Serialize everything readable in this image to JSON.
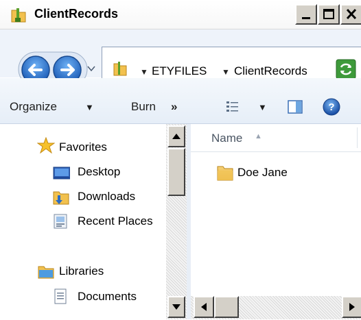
{
  "window": {
    "title": "ClientRecords"
  },
  "address": {
    "crumbs": [
      "ETYFILES",
      "ClientRecords"
    ]
  },
  "commands": {
    "organize": "Organize",
    "burn": "Burn",
    "more": "»"
  },
  "nav_pane": {
    "favorites": {
      "header": "Favorites",
      "items": [
        "Desktop",
        "Downloads",
        "Recent Places"
      ]
    },
    "libraries": {
      "header": "Libraries",
      "items": [
        "Documents"
      ]
    }
  },
  "content": {
    "columns": [
      {
        "label": "Name",
        "sort": "ascending"
      }
    ],
    "items": [
      {
        "name": "Doe Jane",
        "type": "folder"
      }
    ]
  },
  "colors": {
    "accent": "#2b6cc4",
    "folder": "#e8b23a"
  }
}
